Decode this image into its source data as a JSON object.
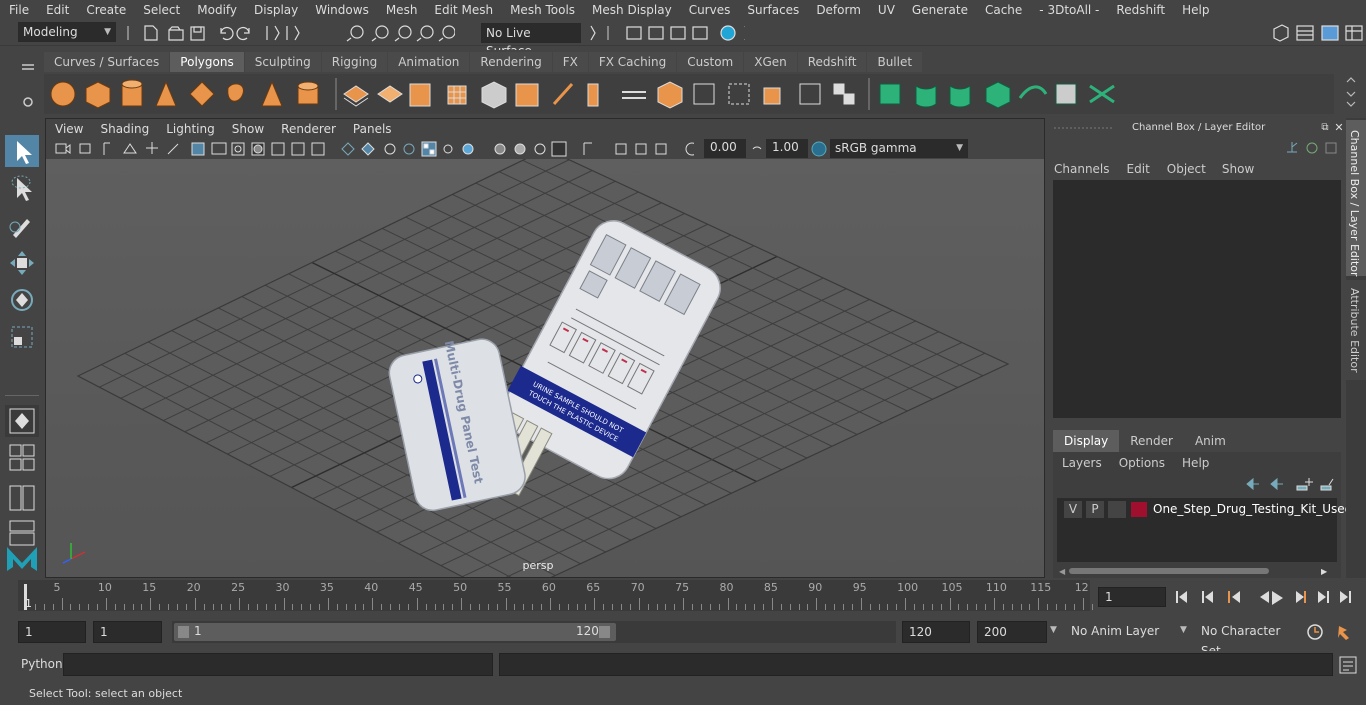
{
  "menu": [
    "File",
    "Edit",
    "Create",
    "Select",
    "Modify",
    "Display",
    "Windows",
    "Mesh",
    "Edit Mesh",
    "Mesh Tools",
    "Mesh Display",
    "Curves",
    "Surfaces",
    "Deform",
    "UV",
    "Generate",
    "Cache",
    "- 3DtoAll -",
    "Redshift",
    "Help"
  ],
  "status": {
    "mode": "Modeling",
    "live_surface": "No Live Surface"
  },
  "shelf": {
    "tabs": [
      "Curves / Surfaces",
      "Polygons",
      "Sculpting",
      "Rigging",
      "Animation",
      "Rendering",
      "FX",
      "FX Caching",
      "Custom",
      "XGen",
      "Redshift",
      "Bullet"
    ],
    "active_tab": "Polygons"
  },
  "viewport": {
    "menu": [
      "View",
      "Shading",
      "Lighting",
      "Show",
      "Renderer",
      "Panels"
    ],
    "exposure": "0.00",
    "gamma": "1.00",
    "colorspace": "sRGB gamma",
    "camera_label": "persp",
    "model_text": {
      "cover_title": "Multi-Drug Panel Test",
      "warning_line1": "URINE SAMPLE SHOULD NOT",
      "warning_line2": "TOUCH THE PLASTIC DEVICE"
    }
  },
  "channelbox": {
    "title": "Channel Box / Layer Editor",
    "menu": [
      "Channels",
      "Edit",
      "Object",
      "Show"
    ]
  },
  "layers": {
    "tabs": [
      "Display",
      "Render",
      "Anim"
    ],
    "active_tab": "Display",
    "menu": [
      "Layers",
      "Options",
      "Help"
    ],
    "rows": [
      {
        "v": "V",
        "p": "P",
        "color": "#a0102e",
        "name": "One_Step_Drug_Testing_Kit_Used"
      }
    ]
  },
  "side_tabs": {
    "channel": "Channel Box / Layer Editor",
    "attr": "Attribute Editor"
  },
  "timeline": {
    "ticks": [
      "5",
      "10",
      "15",
      "20",
      "25",
      "30",
      "35",
      "40",
      "45",
      "50",
      "55",
      "60",
      "65",
      "70",
      "75",
      "80",
      "85",
      "90",
      "95",
      "100",
      "105",
      "110",
      "115",
      "12"
    ],
    "start_label": "1",
    "current_frame": "1"
  },
  "range": {
    "start": "1",
    "current": "1",
    "slider_start": "1",
    "slider_end": "120",
    "end": "120",
    "max": "200",
    "anim_layer": "No Anim Layer",
    "char_set": "No Character Set"
  },
  "python": {
    "label": "Python"
  },
  "help": {
    "text": "Select Tool: select an object"
  }
}
